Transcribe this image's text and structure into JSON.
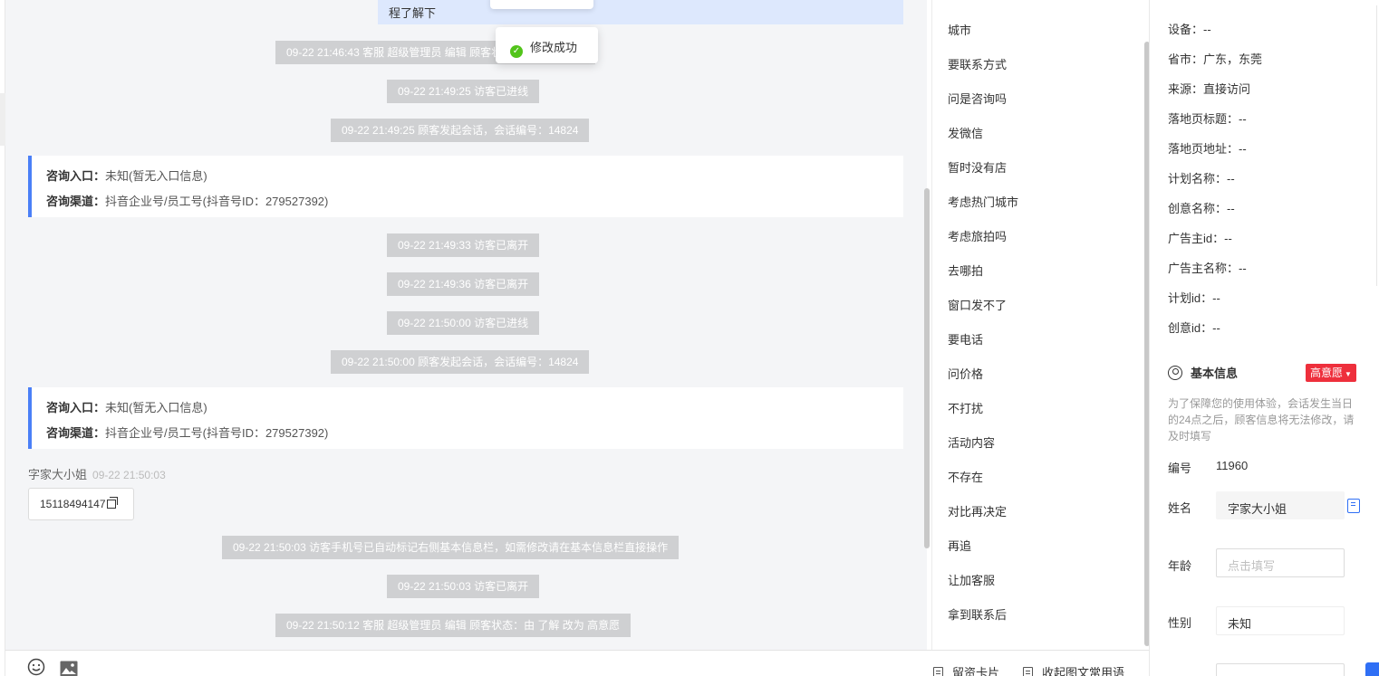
{
  "chat": {
    "top_bubble_text": "程了解下",
    "toast": "修改成功",
    "system_messages": [
      "09-22 21:46:43 客服 超级管理员 编辑 顾客状态：由 改为 了解",
      "09-22 21:49:25 访客已进线",
      "09-22 21:49:25 顾客发起会话，会话编号：14824",
      "09-22 21:49:33 访客已离开",
      "09-22 21:49:36 访客已离开",
      "09-22 21:50:00 访客已进线",
      "09-22 21:50:00 顾客发起会话，会话编号：14824",
      "09-22 21:50:03 访客手机号已自动标记右侧基本信息栏，如需修改请在基本信息栏直接操作",
      "09-22 21:50:03 访客已离开",
      "09-22 21:50:12 客服 超级管理员 编辑 顾客状态：由 了解 改为 高意愿"
    ],
    "info_cards": [
      {
        "entry_label": "咨询入口：",
        "entry_value": "未知(暂无入口信息)",
        "channel_label": "咨询渠道：",
        "channel_value": "抖音企业号/员工号(抖音号ID：279527392)"
      },
      {
        "entry_label": "咨询入口：",
        "entry_value": "未知(暂无入口信息)",
        "channel_label": "咨询渠道：",
        "channel_value": "抖音企业号/员工号(抖音号ID：279527392)"
      }
    ],
    "visitor_message": {
      "sender": "字家大小姐",
      "time": "09-22 21:50:03",
      "text": "15118494147"
    }
  },
  "toolbar": {
    "emoji_icon": "smile-icon",
    "image_icon": "image-icon",
    "card_label": "留资卡片",
    "collapse_label": "收起图文常用语"
  },
  "phrases": [
    "城市",
    "要联系方式",
    "问是咨询吗",
    "发微信",
    "暂时没有店",
    "考虑热门城市",
    "考虑旅拍吗",
    "去哪拍",
    "窗口发不了",
    "要电话",
    "问价格",
    "不打扰",
    "活动内容",
    "不存在",
    "对比再决定",
    "再追",
    "让加客服",
    "拿到联系后"
  ],
  "panel": {
    "fields": [
      "设备：--",
      "省市：广东，东莞",
      "来源：直接访问",
      "落地页标题：--",
      "落地页地址：--",
      "计划名称：--",
      "创意名称：--",
      "广告主id：--",
      "广告主名称：--",
      "计划id：--",
      "创意id：--"
    ],
    "basic_title": "基本信息",
    "intent_badge": "高意愿",
    "notice": "为了保障您的使用体验，会话发生当日的24点之后，顾客信息将无法修改，请及时填写",
    "id_label": "编号",
    "id_value": "11960",
    "name_label": "姓名",
    "name_value": "字家大小姐",
    "age_label": "年龄",
    "age_placeholder": "点击填写",
    "gender_label": "性别",
    "gender_value": "未知"
  },
  "colors": {
    "accent": "#4a7ff7",
    "badge": "#ee2f3c",
    "toast_ok": "#52c41a",
    "system_bg": "#cfd0d2",
    "chat_bg": "#f4f5f7"
  }
}
